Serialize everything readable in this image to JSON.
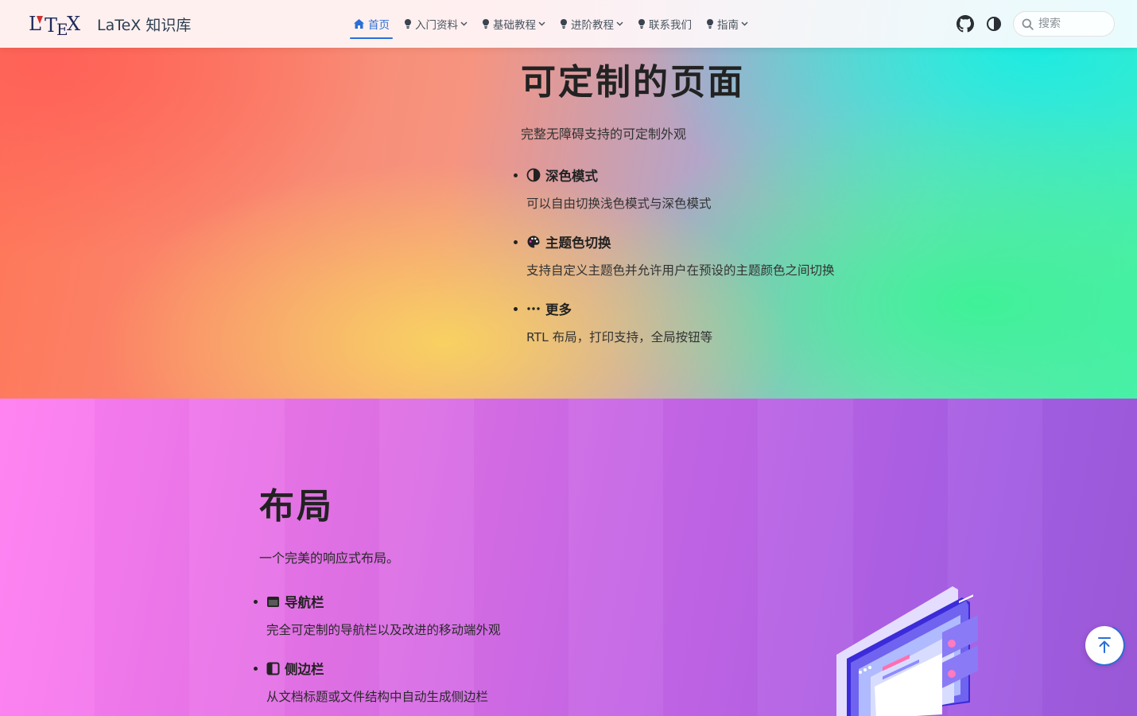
{
  "navbar": {
    "site_name": "LaTeX 知识库",
    "links": [
      {
        "label": "首页",
        "icon": "home-icon",
        "active": true,
        "dropdown": false
      },
      {
        "label": "入门资料",
        "icon": "lightbulb-icon",
        "active": false,
        "dropdown": true
      },
      {
        "label": "基础教程",
        "icon": "lightbulb-icon",
        "active": false,
        "dropdown": true
      },
      {
        "label": "进阶教程",
        "icon": "lightbulb-icon",
        "active": false,
        "dropdown": true
      },
      {
        "label": "联系我们",
        "icon": "lightbulb-icon",
        "active": false,
        "dropdown": false
      },
      {
        "label": "指南",
        "icon": "lightbulb-icon",
        "active": false,
        "dropdown": true
      }
    ],
    "search_placeholder": "搜索",
    "accent_color": "#2b6fd6"
  },
  "section_custom": {
    "title": "可定制的页面",
    "description": "完整无障碍支持的可定制外观",
    "features": [
      {
        "icon": "contrast-icon",
        "title": "深色模式",
        "desc": "可以自由切换浅色模式与深色模式"
      },
      {
        "icon": "palette-icon",
        "title": "主题色切换",
        "desc": "支持自定义主题色并允许用户在预设的主题颜色之间切换"
      },
      {
        "icon": "ellipsis-icon",
        "title": "更多",
        "desc": "RTL 布局，打印支持，全局按钮等"
      }
    ]
  },
  "section_layout": {
    "title": "布局",
    "description": "一个完美的响应式布局。",
    "features": [
      {
        "icon": "window-icon",
        "title": "导航栏",
        "desc": "完全可定制的导航栏以及改进的移动端外观"
      },
      {
        "icon": "sidebar-icon",
        "title": "侧边栏",
        "desc": "从文档标题或文件结构中自动生成侧边栏"
      }
    ]
  }
}
